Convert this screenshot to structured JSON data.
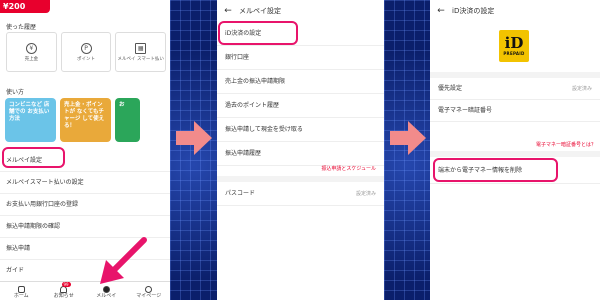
{
  "phone1": {
    "badge": "¥200",
    "history_title": "使った履歴",
    "history": [
      {
        "label": "売上金",
        "icon": "yen-icon"
      },
      {
        "label": "ポイント",
        "icon": "point-icon"
      },
      {
        "label": "メルペイ スマート払い",
        "icon": "calendar-icon"
      }
    ],
    "ways_title": "使い方",
    "ways": [
      "コンビニなど 店舗での お支払い方法",
      "売上金・ポイントが なくてもチャージ して使える！",
      "お"
    ],
    "menu": [
      "メルペイ設定",
      "メルペイスマート払いの設定",
      "お支払い用銀行口座の登録",
      "振込申請期限の確認",
      "振込申請",
      "ガイド"
    ],
    "tabs": [
      {
        "label": "ホーム"
      },
      {
        "label": "お知らせ",
        "badge": "99"
      },
      {
        "label": "メルペイ"
      },
      {
        "label": "マイページ"
      }
    ]
  },
  "phone2": {
    "title": "メルペイ設定",
    "menu": [
      "iD決済の設定",
      "銀行口座",
      "売上金の振込申請期限",
      "過去のポイント履歴",
      "振込申請して現金を受け取る",
      "振込申請履歴"
    ],
    "schedule_link": "振込申請とスケジュール",
    "passcode_label": "パスコード",
    "passcode_value": "設定済み"
  },
  "phone3": {
    "title": "iD決済の設定",
    "logo_text": "iD",
    "logo_sub": "PREPAID",
    "priority_label": "優先設定",
    "priority_value": "設定済み",
    "emoney_label": "電子マネー暗証番号",
    "forgot_link": "電子マネー暗証番号とは？",
    "delete_label": "端末から電子マネー情報を削除"
  },
  "colors": {
    "accent": "#e8002d",
    "highlight": "#e8146b",
    "bg_blue": "#0b1f6b"
  }
}
